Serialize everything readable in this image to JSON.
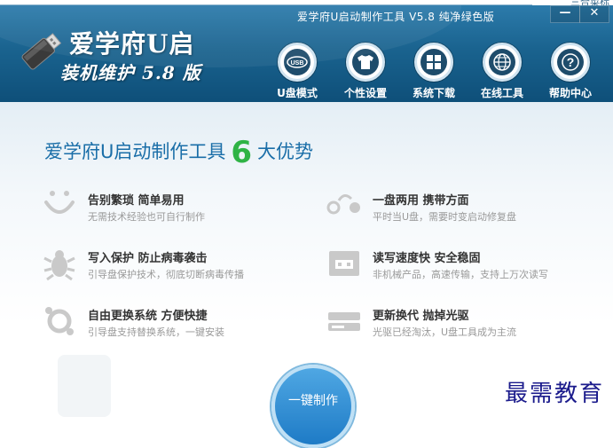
{
  "window": {
    "title": "爱学府U启动制作工具 V5.8 纯净绿色版",
    "min_symbol": "—",
    "close_symbol": "✕",
    "corner_text": "三合菜标"
  },
  "brand": {
    "name": "爱学府U启",
    "subtitle": "装机维护 5.8 版",
    "logo_icon": "usb-drive-icon"
  },
  "nav": [
    {
      "label": "U盘模式",
      "icon": "usb-icon"
    },
    {
      "label": "个性设置",
      "icon": "tshirt-icon"
    },
    {
      "label": "系统下载",
      "icon": "windows-icon"
    },
    {
      "label": "在线工具",
      "icon": "globe-icon"
    },
    {
      "label": "帮助中心",
      "icon": "help-icon"
    }
  ],
  "headline": {
    "prefix": "爱学府U启动制作工具",
    "number": "6",
    "suffix": "大优势"
  },
  "features": [
    {
      "title": "告别繁琐 简单易用",
      "desc": "无需技术经验也可自行制作",
      "icon": "smile-icon"
    },
    {
      "title": "一盘两用 携带方面",
      "desc": "平时当U盘，需要时变启动修复盘",
      "icon": "toggle-icon"
    },
    {
      "title": "写入保护 防止病毒袭击",
      "desc": "引导盘保护技术，彻底切断病毒传播",
      "icon": "bug-icon"
    },
    {
      "title": "读写速度快 安全稳固",
      "desc": "非机械产品，高速传输，支持上万次读写",
      "icon": "usb-port-icon"
    },
    {
      "title": "自由更换系统 方便快捷",
      "desc": "引导盘支持替换系统，一键安装",
      "icon": "refresh-icon"
    },
    {
      "title": "更新换代 抛掉光驱",
      "desc": "光驱已经淘汰，U盘工具成为主流",
      "icon": "drive-icon"
    }
  ],
  "action": {
    "label": "一键制作"
  },
  "watermark": "最需教育",
  "colors": {
    "header": "#1a638f",
    "headline": "#1a6ea8",
    "accent_green": "#2fb345",
    "button": "#1e7bc6"
  }
}
